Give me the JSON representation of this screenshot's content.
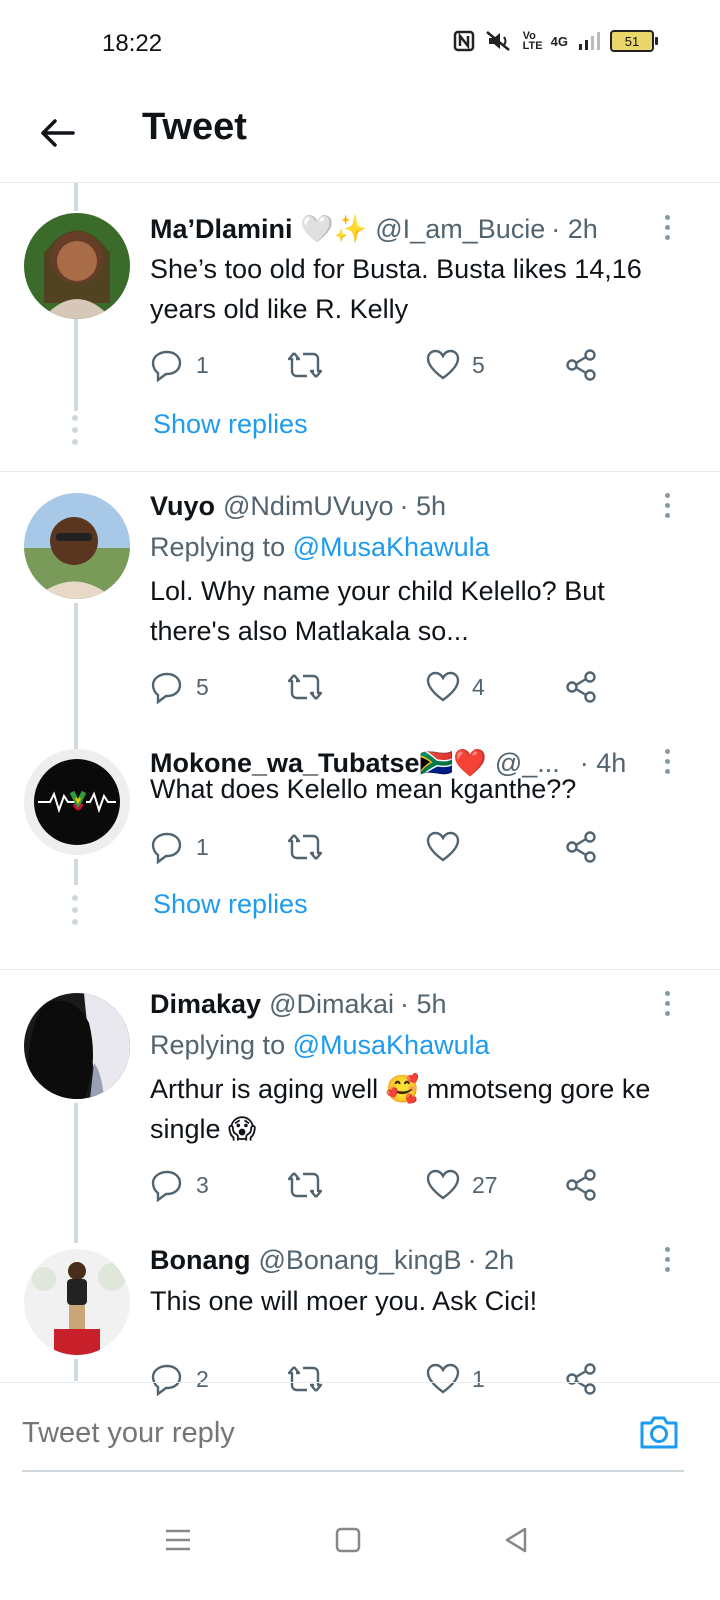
{
  "status": {
    "time": "18:22",
    "network": "4G",
    "volte": "Vo LTE",
    "battery": "51"
  },
  "header": {
    "back_icon": "arrow-left-icon",
    "title": "Tweet"
  },
  "tweets": [
    {
      "name": "Ma’Dlamini 🤍✨",
      "handle": "@I_am_Bucie",
      "time": "· 2h",
      "reply_to_prefix": "",
      "reply_to": "",
      "text": "She’s too old for Busta. Busta likes 14,16 years old like R. Kelly",
      "replies": "1",
      "retweets": "",
      "likes": "5",
      "show_replies": "Show replies"
    },
    {
      "name": "Vuyo",
      "handle": "@NdimUVuyo",
      "time": "· 5h",
      "reply_to_prefix": "Replying to",
      "reply_to": "@MusaKhawula",
      "text": "Lol. Why name your child Kelello? But there's also Matlakala so...",
      "replies": "5",
      "retweets": "",
      "likes": "4"
    },
    {
      "name": "Mokone_wa_Tubatse🇿🇦❤️",
      "handle": "@_...",
      "time": "· 4h",
      "text": "What does Kelello mean kganthe??",
      "replies": "1",
      "retweets": "",
      "likes": "",
      "show_replies": "Show replies"
    },
    {
      "name": "Dimakay",
      "handle": "@Dimakai",
      "time": "· 5h",
      "reply_to_prefix": "Replying to",
      "reply_to": "@MusaKhawula",
      "text": "Arthur is aging well 🥰 mmotseng gore ke single 😱",
      "replies": "3",
      "retweets": "",
      "likes": "27"
    },
    {
      "name": "Bonang",
      "handle": "@Bonang_kingB",
      "time": "· 2h",
      "text": "This one will moer you. Ask Cici!",
      "replies": "2",
      "retweets": "",
      "likes": "1"
    }
  ],
  "composer": {
    "placeholder": "Tweet your reply",
    "camera_icon": "camera-icon"
  },
  "navbar": {
    "menu_icon": "menu-icon",
    "home_icon": "home-square-icon",
    "back_icon": "back-triangle-icon"
  },
  "colors": {
    "accent": "#1d9bf0",
    "secondary_text": "#536471",
    "thread_line": "#cfd9de"
  }
}
